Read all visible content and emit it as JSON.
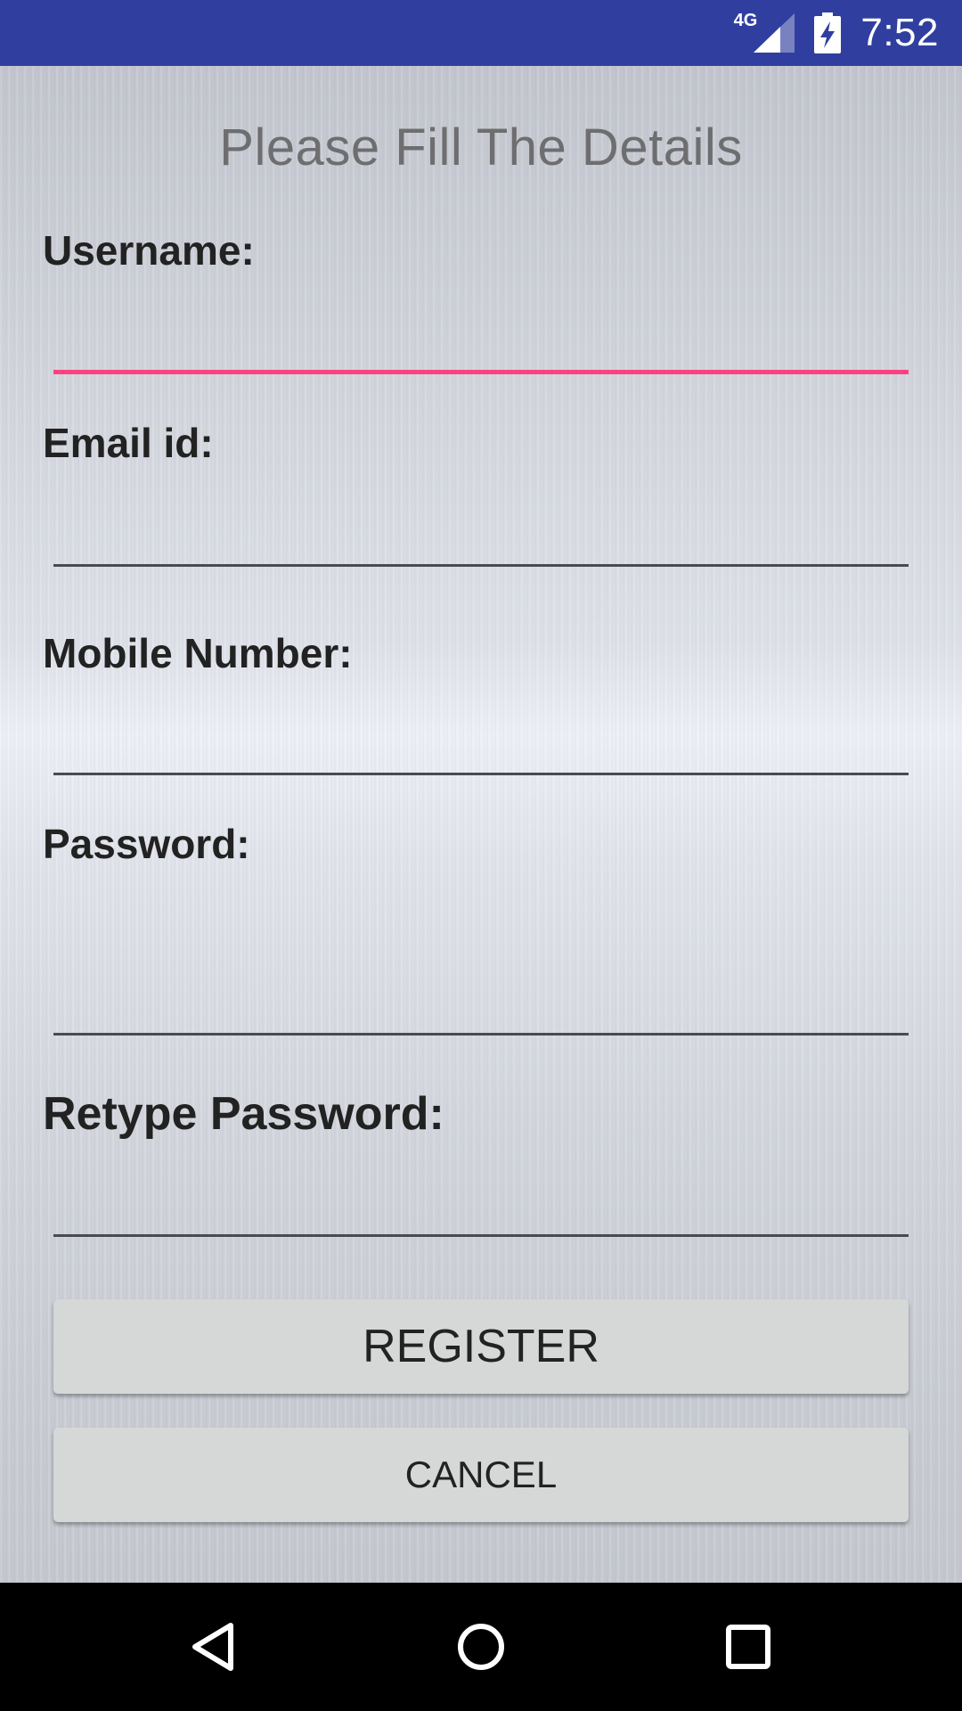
{
  "status_bar": {
    "network_type": "4G",
    "time": "7:52",
    "icons": [
      "signal-icon",
      "battery-charging-icon"
    ],
    "background_color": "#303f9f"
  },
  "form": {
    "title": "Please Fill The Details",
    "fields": {
      "username": {
        "label": "Username:",
        "value": ""
      },
      "email": {
        "label": "Email id:",
        "value": ""
      },
      "mobile": {
        "label": "Mobile Number:",
        "value": ""
      },
      "password": {
        "label": "Password:",
        "value": ""
      },
      "retype_password": {
        "label": "Retype Password:",
        "value": ""
      }
    },
    "focused_field": "username",
    "accent_color": "#ff4081"
  },
  "buttons": {
    "register_label": "REGISTER",
    "cancel_label": "CANCEL"
  },
  "nav_bar": {
    "icons": [
      "back-icon",
      "home-icon",
      "recent-apps-icon"
    ]
  }
}
